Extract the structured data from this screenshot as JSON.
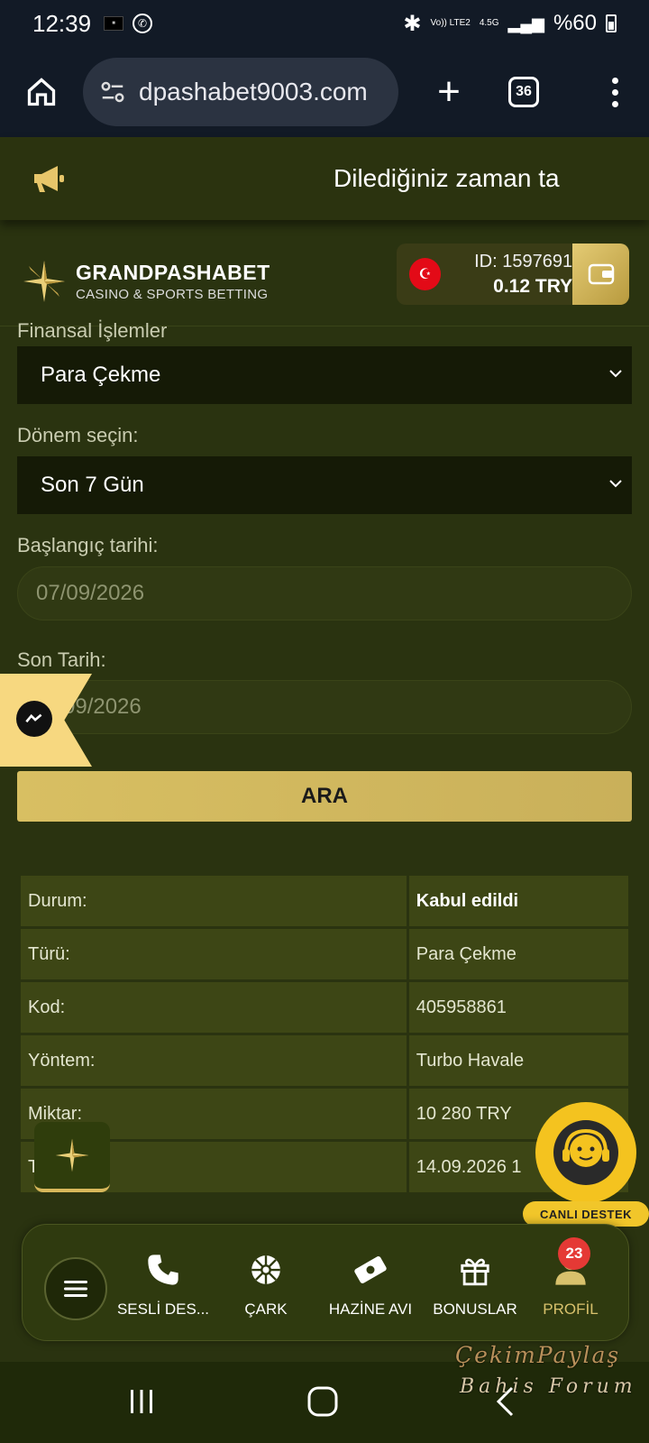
{
  "status_bar": {
    "time": "12:39",
    "volte": "Vo)) LTE2",
    "network": "4.5G",
    "battery": "%60"
  },
  "browser": {
    "url": "dpashabet9003.com",
    "tabs_count": "36"
  },
  "announcement": {
    "text": "Dilediğiniz zaman ta"
  },
  "header": {
    "logo_main": "GRANDPASHABET",
    "logo_sub": "CASINO & SPORTS BETTING",
    "account_id": "ID: 1597691",
    "balance": "0.12   TRY"
  },
  "form": {
    "section_label": "Finansal İşlemler",
    "transaction_type": "Para Çekme",
    "period_label": "Dönem seçin:",
    "period_value": "Son 7 Gün",
    "start_label": "Başlangıç tarihi:",
    "start_value": "07/09/2026",
    "end_label": "Son Tarih:",
    "end_value": "09/2026",
    "search_button": "ARA"
  },
  "details": [
    {
      "key": "Durum:",
      "value": "Kabul edildi"
    },
    {
      "key": "Türü:",
      "value": "Para Çekme"
    },
    {
      "key": "Kod:",
      "value": "405958861"
    },
    {
      "key": "Yöntem:",
      "value": "Turbo Havale"
    },
    {
      "key": "Miktar:",
      "value": "10 280 TRY"
    },
    {
      "key": "T",
      "value": "14.09.2026 1"
    }
  ],
  "support": {
    "label": "CANLI DESTEK"
  },
  "bottom_nav": {
    "items": [
      {
        "label": "SESLİ DES..."
      },
      {
        "label": "ÇARK"
      },
      {
        "label": "HAZİNE AVI"
      },
      {
        "label": "BONUSLAR"
      },
      {
        "label": "PROFİL"
      }
    ],
    "profile_badge": "23"
  },
  "watermark": {
    "line1": "ÇekimPaylaş",
    "line2": "Bahis Forum"
  },
  "colors": {
    "accent_gold": "#d8bf62",
    "page_bg": "#2a3310",
    "badge_red": "#e53935"
  }
}
